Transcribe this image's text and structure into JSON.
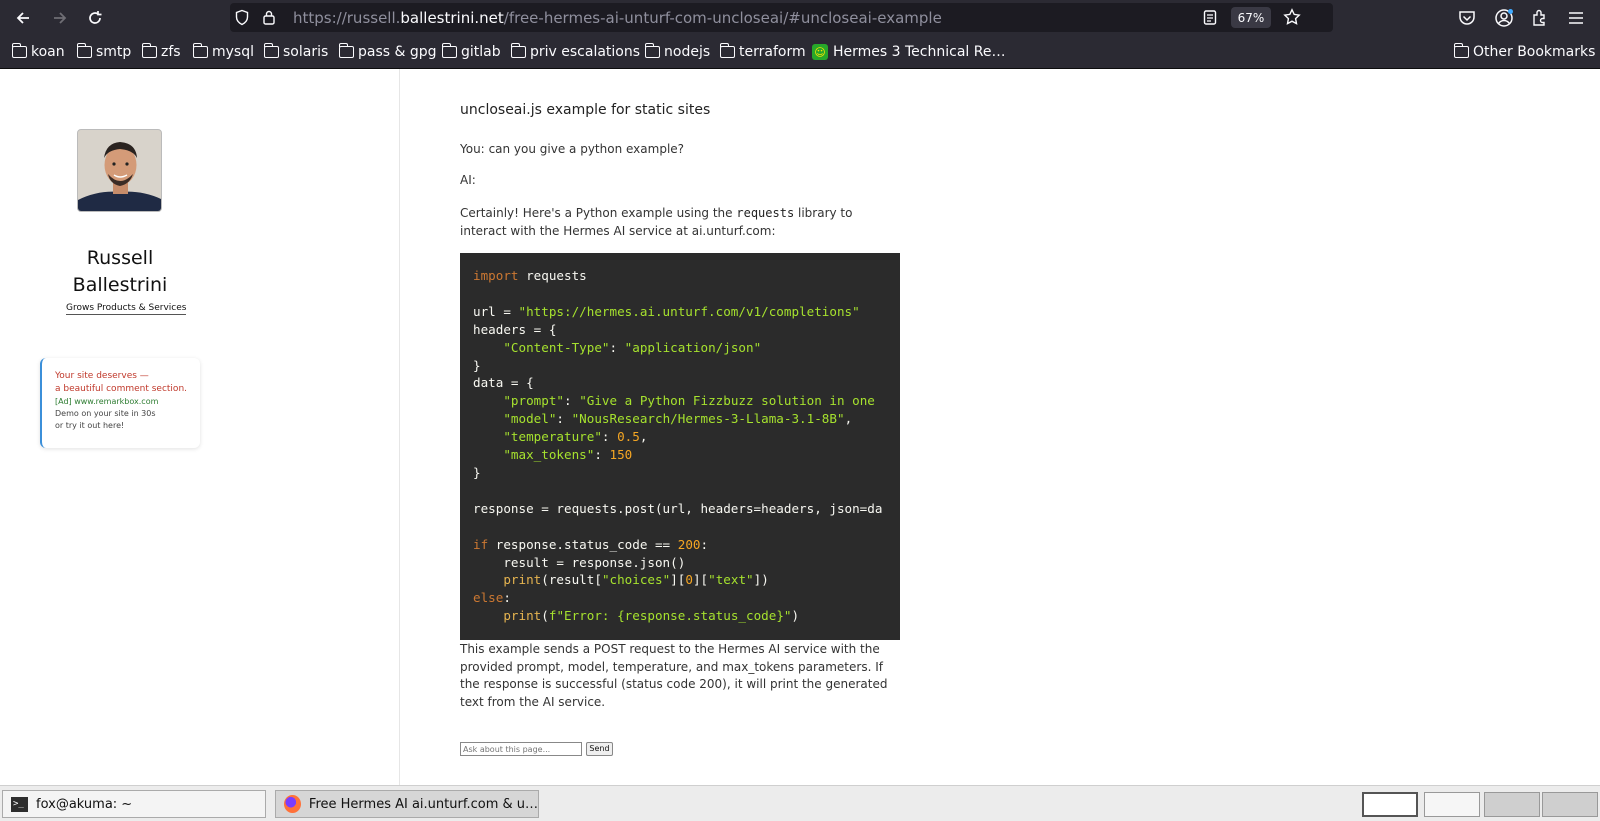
{
  "browser": {
    "url_prefix": "https://russell.",
    "url_host": "ballestrini.net",
    "url_path": "/free-hermes-ai-unturf-com-uncloseai/#uncloseai-example",
    "zoom": "67%"
  },
  "bookmarks": [
    {
      "label": "koan"
    },
    {
      "label": "smtp"
    },
    {
      "label": "zfs"
    },
    {
      "label": "mysql"
    },
    {
      "label": "solaris"
    },
    {
      "label": "pass & gpg"
    },
    {
      "label": "gitlab"
    },
    {
      "label": "priv escalations"
    },
    {
      "label": "nodejs"
    },
    {
      "label": "terraform"
    },
    {
      "label": "Hermes 3 Technical Re…"
    }
  ],
  "other_bookmarks": "Other Bookmarks",
  "sidebar": {
    "name_line1": "Russell",
    "name_line2": "Ballestrini",
    "tagline": "Grows Products & Services",
    "ad": {
      "line1": "Your site deserves —",
      "line2": "a beautiful comment section.",
      "sponsor": "[Ad] www.remarkbox.com",
      "line3": "Demo on your site in 30s",
      "line4": "or try it out here!"
    }
  },
  "main": {
    "title": "uncloseai.js example for static sites",
    "you_label": "You:",
    "you_text": "can you give a python example?",
    "ai_label": "AI:",
    "intro_before": "Certainly! Here's a Python example using the",
    "intro_code": "requests",
    "intro_after": "library to interact with the Hermes AI service at ai.unturf.com:",
    "outro": "This example sends a POST request to the Hermes AI service with the provided prompt, model, temperature, and max_tokens parameters. If the response is successful (status code 200), it will print the generated text from the AI service.",
    "ask_placeholder": "Ask about this page...",
    "send_label": "Send"
  },
  "code": {
    "import_kw": "import",
    "import_mod": " requests",
    "url_var": "url = ",
    "url_str": "\"https://hermes.ai.unturf.com/v1/completions\"",
    "headers_open": "headers = {",
    "ct_key": "\"Content-Type\"",
    "ct_val": "\"application/json\"",
    "close_brace": "}",
    "data_open": "data = {",
    "prompt_key": "\"prompt\"",
    "prompt_val": "\"Give a Python Fizzbuzz solution in one",
    "model_key": "\"model\"",
    "model_val": "\"NousResearch/Hermes-3-Llama-3.1-8B\"",
    "temp_key": "\"temperature\"",
    "temp_val": "0.5",
    "tokens_key": "\"max_tokens\"",
    "tokens_val": "150",
    "response_line": "response = requests.post(url, headers=headers, json=da",
    "if_kw": "if",
    "if_cond": " response.status_code == ",
    "if_num": "200",
    "result_line": "    result = response.json()",
    "print_fn": "print",
    "choices_str": "\"choices\"",
    "zero": "0",
    "text_str": "\"text\"",
    "else_kw": "else",
    "error_str": "f\"Error: {response.status_code}\""
  },
  "taskbar": {
    "terminal": "fox@akuma: ~",
    "firefox": "Free Hermes AI ai.unturf.com & u…"
  }
}
